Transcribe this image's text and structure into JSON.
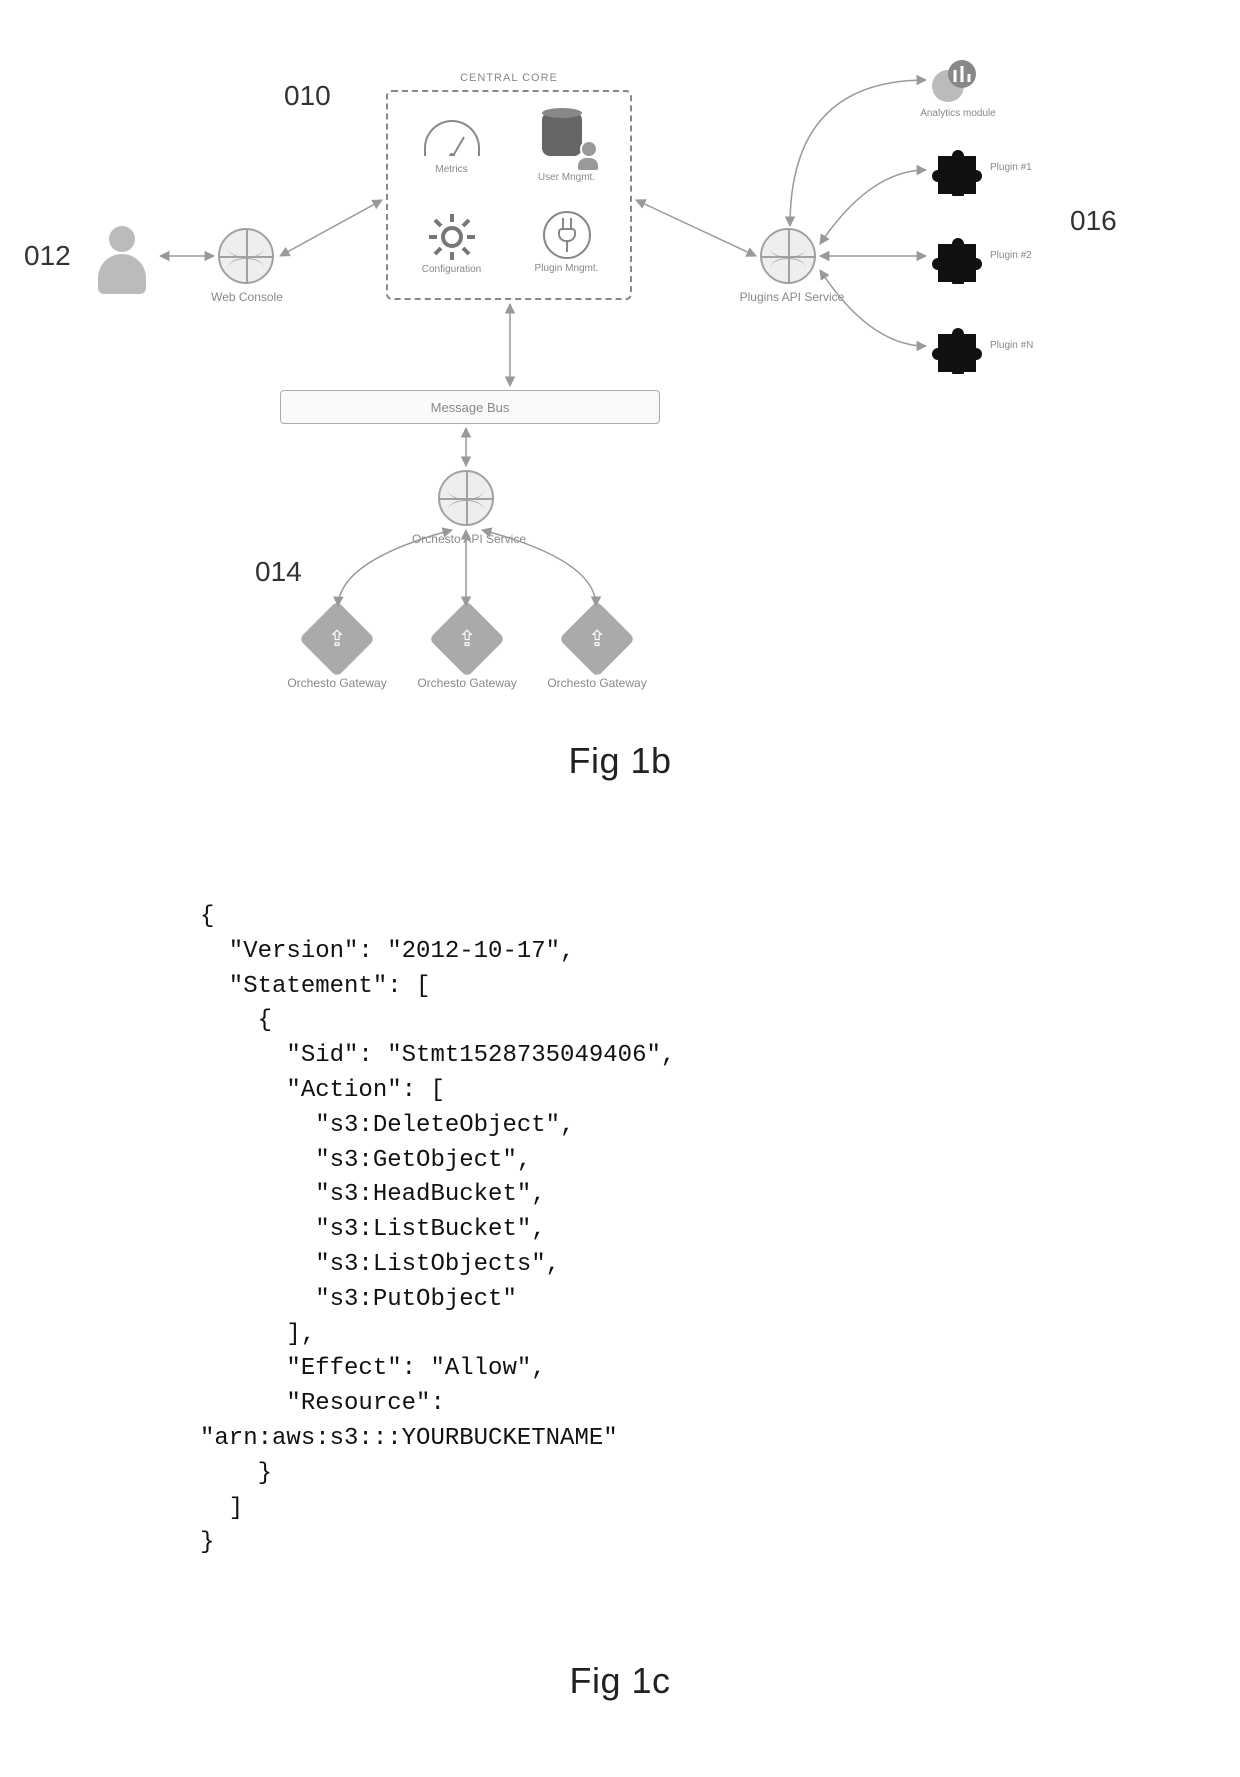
{
  "refs": {
    "r010": "010",
    "r012": "012",
    "r014": "014",
    "r016": "016"
  },
  "diagram": {
    "core_title": "CENTRAL CORE",
    "metrics": "Metrics",
    "user_mgmt": "User Mngmt.",
    "configuration": "Configuration",
    "plugin_mgmt": "Plugin Mngmt.",
    "web_console": "Web Console",
    "message_bus": "Message Bus",
    "api_service": "Orchesto API Service",
    "gateway": "Orchesto Gateway",
    "plugins_api": "Plugins API Service",
    "analytics": "Analytics module",
    "plugin1": "Plugin #1",
    "plugin2": "Plugin #2",
    "pluginN": "Plugin #N"
  },
  "captions": {
    "fig1b": "Fig 1b",
    "fig1c": "Fig 1c"
  },
  "policy_code": "{\n  \"Version\": \"2012-10-17\",\n  \"Statement\": [\n    {\n      \"Sid\": \"Stmt1528735049406\",\n      \"Action\": [\n        \"s3:DeleteObject\",\n        \"s3:GetObject\",\n        \"s3:HeadBucket\",\n        \"s3:ListBucket\",\n        \"s3:ListObjects\",\n        \"s3:PutObject\"\n      ],\n      \"Effect\": \"Allow\",\n      \"Resource\":\n\"arn:aws:s3:::YOURBUCKETNAME\"\n    }\n  ]\n}"
}
